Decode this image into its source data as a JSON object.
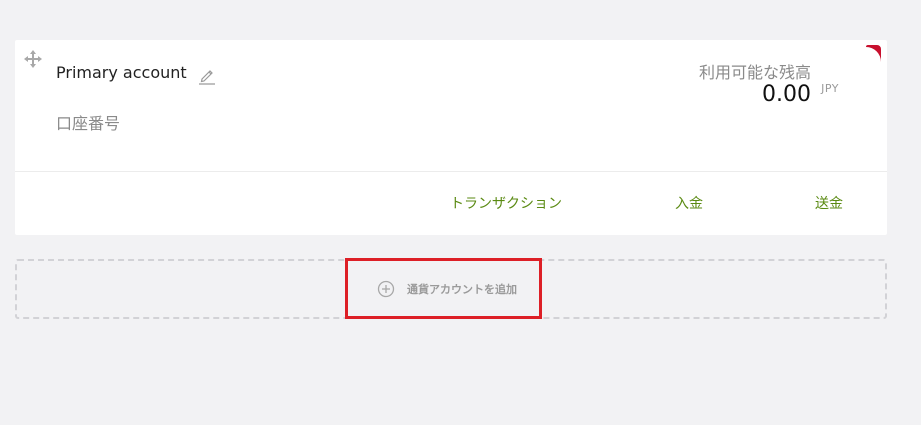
{
  "account": {
    "name": "Primary account",
    "number_label": "口座番号",
    "balance_label": "利用可能な残高",
    "balance_amount": "0.00",
    "balance_currency": "JPY",
    "actions": {
      "transactions": "トランザクション",
      "deposit": "入金",
      "send": "送金"
    }
  },
  "add_account": {
    "label": "通貨アカウントを追加"
  },
  "icons": {
    "drag": "move-icon",
    "edit": "pencil-icon",
    "flag": "currency-flag-icon",
    "add": "plus-circle-icon"
  },
  "colors": {
    "background": "#f2f2f4",
    "card": "#ffffff",
    "link": "#5a8a12",
    "muted": "#8a8a8a",
    "flag": "#c8102e",
    "highlight": "#dd1f26"
  }
}
